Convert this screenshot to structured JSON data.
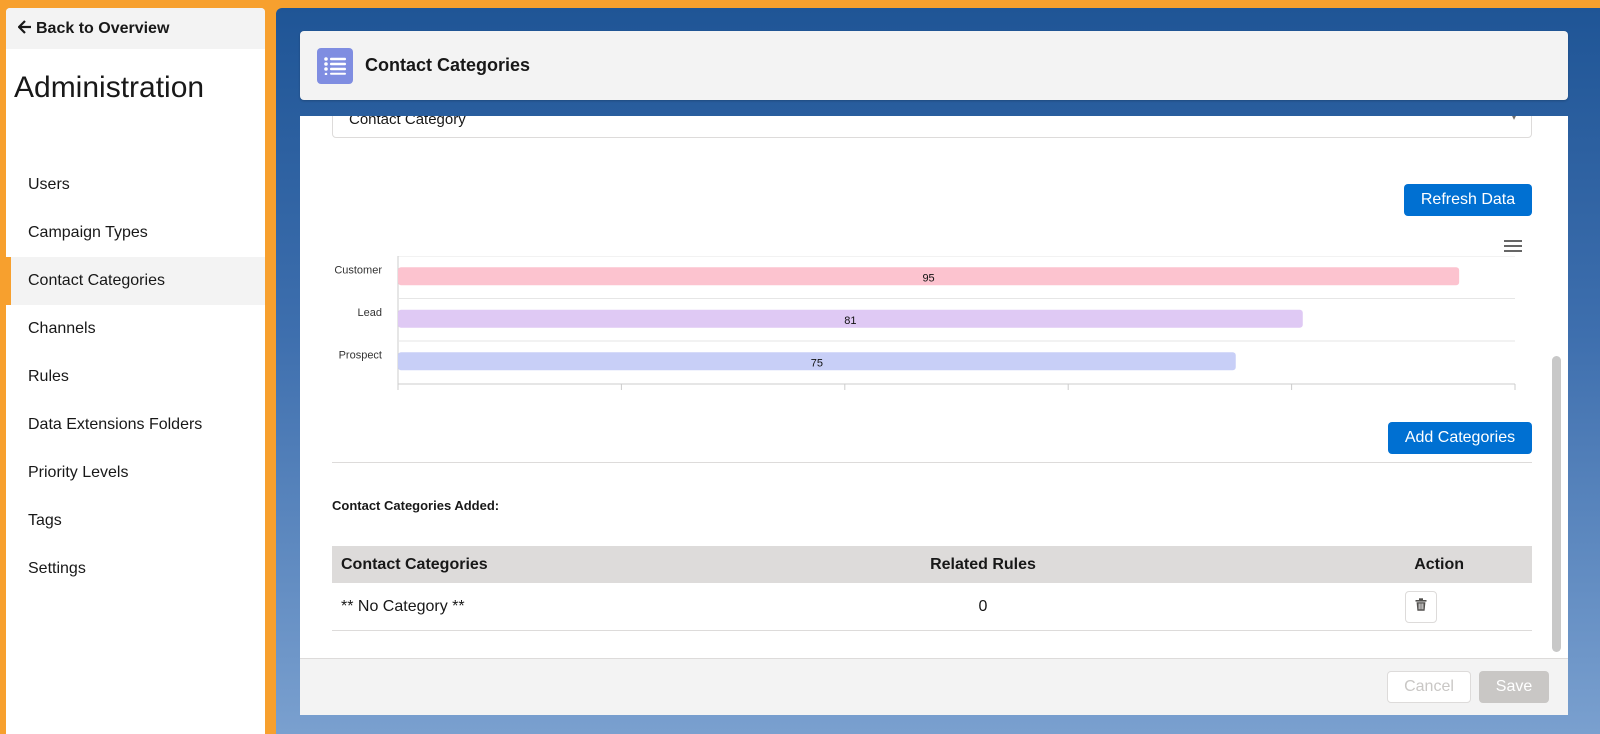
{
  "sidebar": {
    "back_label": "Back to Overview",
    "title": "Administration",
    "items": [
      {
        "label": "Users"
      },
      {
        "label": "Campaign Types"
      },
      {
        "label": "Contact Categories"
      },
      {
        "label": "Channels"
      },
      {
        "label": "Rules"
      },
      {
        "label": "Data Extensions Folders"
      },
      {
        "label": "Priority Levels"
      },
      {
        "label": "Tags"
      },
      {
        "label": "Settings"
      }
    ],
    "active_item": "Contact Categories"
  },
  "header": {
    "icon": "list-icon",
    "title": "Contact Categories"
  },
  "select": {
    "value": "Contact Category"
  },
  "buttons": {
    "refresh": "Refresh Data",
    "add": "Add Categories",
    "cancel": "Cancel",
    "save": "Save"
  },
  "chart_data": {
    "type": "bar",
    "orientation": "horizontal",
    "categories": [
      "Customer",
      "Lead",
      "Prospect"
    ],
    "values": [
      95,
      81,
      75
    ],
    "colors": [
      "#fcc3cf",
      "#dfc9f4",
      "#c8cff7"
    ],
    "xlim": [
      0,
      100
    ]
  },
  "section_label": "Contact Categories Added:",
  "table": {
    "headers": [
      "Contact Categories",
      "Related Rules",
      "Action"
    ],
    "rows": [
      {
        "category": "** No Category **",
        "related_rules": "0",
        "action_icon": "trash-icon"
      }
    ]
  },
  "colors": {
    "accent": "#f7a02e",
    "brand": "#0070d2",
    "header_icon_bg": "#7f8de1"
  }
}
